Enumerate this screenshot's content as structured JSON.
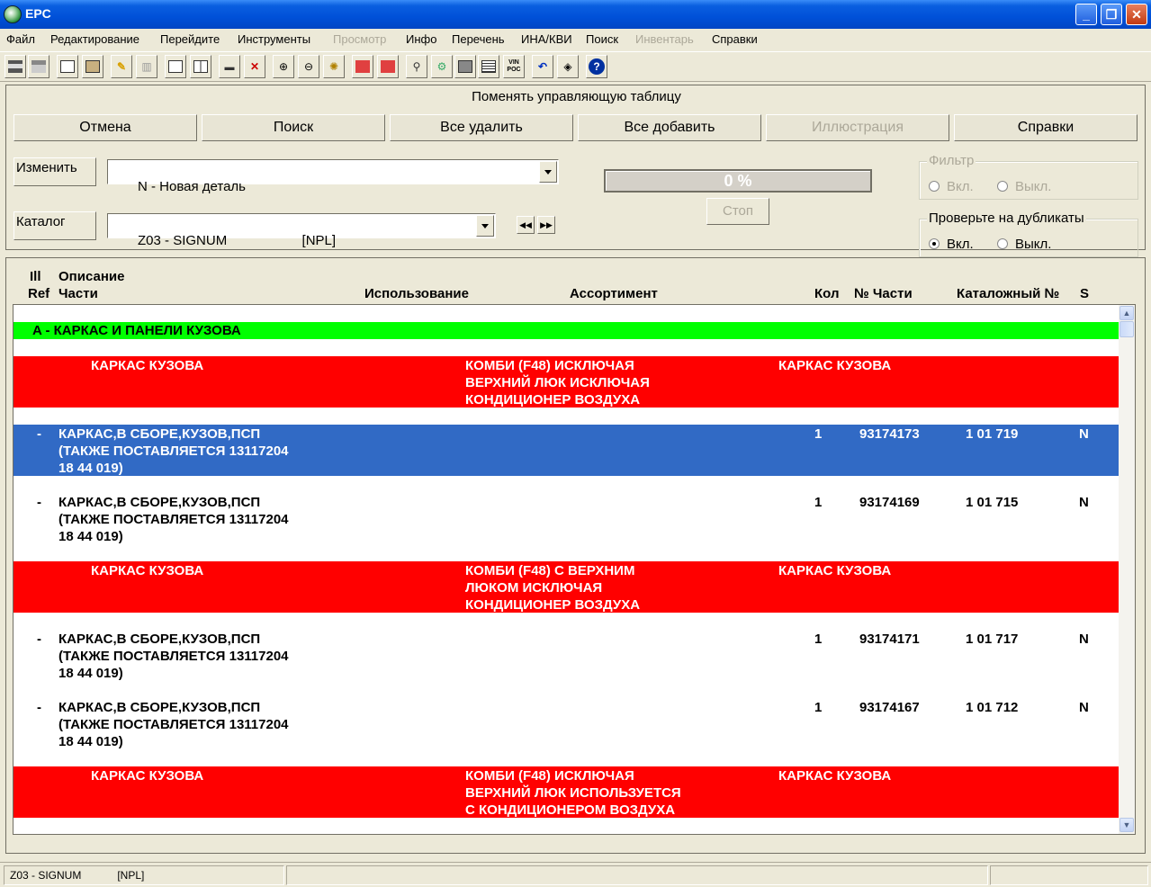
{
  "window": {
    "title": "EPC"
  },
  "menu": [
    "Файл",
    "Редактирование",
    "Перейдите",
    "Инструменты",
    "Просмотр",
    "Инфо",
    "Перечень",
    "ИНА/КВИ",
    "Поиск",
    "Инвентарь",
    "Справки"
  ],
  "menu_disabled": [
    "Просмотр",
    "Инвентарь"
  ],
  "toolbar_icons": [
    "print-icon",
    "print-preview-icon",
    "copy-icon",
    "paste-icon",
    "pencil-icon",
    "eraser-icon",
    "page-icon",
    "book-icon",
    "car-icon",
    "cross-icon",
    "zoom-in-icon",
    "zoom-out-icon",
    "zoom-fit-icon",
    "flag-up-icon",
    "flag-down-icon",
    "flashlight-icon",
    "gears-icon",
    "monitor-icon",
    "list-icon",
    "vin-poc-icon",
    "undo-icon",
    "layers-icon",
    "help-icon"
  ],
  "toolbar_vin_text": "VIN\nPOC",
  "panel": {
    "title": "Поменять управляющую таблицу",
    "buttons": {
      "cancel": "Отмена",
      "search": "Поиск",
      "remove_all": "Все удалить",
      "add_all": "Все добавить",
      "illustration": "Иллюстрация",
      "help": "Справки"
    },
    "change_label": "Изменить",
    "change_value": "N - Новая деталь",
    "catalog_label": "Каталог",
    "catalog_value": "Z03 - SIGNUM                    [NPL]",
    "progress_text": "0 %",
    "progress_value": 0,
    "stop": "Стоп",
    "filter": {
      "label": "Фильтр",
      "on": "Вкл.",
      "off": "Выкл."
    },
    "duplicates": {
      "label": "Проверьте на дубликаты",
      "on": "Вкл.",
      "off": "Выкл.",
      "selected": "on"
    }
  },
  "columns": {
    "ill_ref_1": "Ill",
    "ill_ref_2": "Ref",
    "desc_1": "Описание",
    "desc_2": "Части",
    "usage": "Использование",
    "assortment": "Ассортимент",
    "qty": "Кол",
    "part_no": "№ Части",
    "catalog_no": "Каталожный №",
    "s": "S"
  },
  "rows": [
    {
      "type": "green",
      "desc": "A - КАРКАС И ПАНЕЛИ КУЗОВА"
    },
    {
      "type": "red",
      "desc": "КАРКАС КУЗОВА",
      "usage": "КОМБИ (F48) ИСКЛЮЧАЯ\nВЕРХНИЙ ЛЮК ИСКЛЮЧАЯ\nКОНДИЦИОНЕР ВОЗДУХА",
      "assortment": "КАРКАС КУЗОВА"
    },
    {
      "type": "sel",
      "ref": "-",
      "desc": "КАРКАС,В СБОРЕ,КУЗОВ,ПСП\n(ТАКЖЕ ПОСТАВЛЯЕТСЯ 13117204\n18 44 019)",
      "qty": "1",
      "part_no": "93174173",
      "catalog_no": "1 01 719",
      "s": "N"
    },
    {
      "type": "norm",
      "ref": "-",
      "desc": "КАРКАС,В СБОРЕ,КУЗОВ,ПСП\n(ТАКЖЕ ПОСТАВЛЯЕТСЯ 13117204\n18 44 019)",
      "qty": "1",
      "part_no": "93174169",
      "catalog_no": "1 01 715",
      "s": "N"
    },
    {
      "type": "red",
      "desc": "КАРКАС КУЗОВА",
      "usage": "КОМБИ (F48) С ВЕРХНИМ\nЛЮКОМ ИСКЛЮЧАЯ\nКОНДИЦИОНЕР ВОЗДУХА",
      "assortment": "КАРКАС КУЗОВА"
    },
    {
      "type": "norm",
      "ref": "-",
      "desc": "КАРКАС,В СБОРЕ,КУЗОВ,ПСП\n(ТАКЖЕ ПОСТАВЛЯЕТСЯ 13117204\n18 44 019)",
      "qty": "1",
      "part_no": "93174171",
      "catalog_no": "1 01 717",
      "s": "N"
    },
    {
      "type": "norm",
      "ref": "-",
      "desc": "КАРКАС,В СБОРЕ,КУЗОВ,ПСП\n(ТАКЖЕ ПОСТАВЛЯЕТСЯ 13117204\n18 44 019)",
      "qty": "1",
      "part_no": "93174167",
      "catalog_no": "1 01 712",
      "s": "N"
    },
    {
      "type": "red",
      "desc": "КАРКАС КУЗОВА",
      "usage": "КОМБИ (F48) ИСКЛЮЧАЯ\nВЕРХНИЙ ЛЮК ИСПОЛЬЗУЕТСЯ\nС КОНДИЦИОНЕРОМ ВОЗДУХА",
      "assortment": "КАРКАС КУЗОВА"
    }
  ],
  "status": {
    "pane1": "Z03 - SIGNUM            [NPL]",
    "pane2": "",
    "pane3": ""
  },
  "colors": {
    "green_row": "#00ff00",
    "red_row": "#ff0000",
    "selected_row": "#316ac5"
  }
}
